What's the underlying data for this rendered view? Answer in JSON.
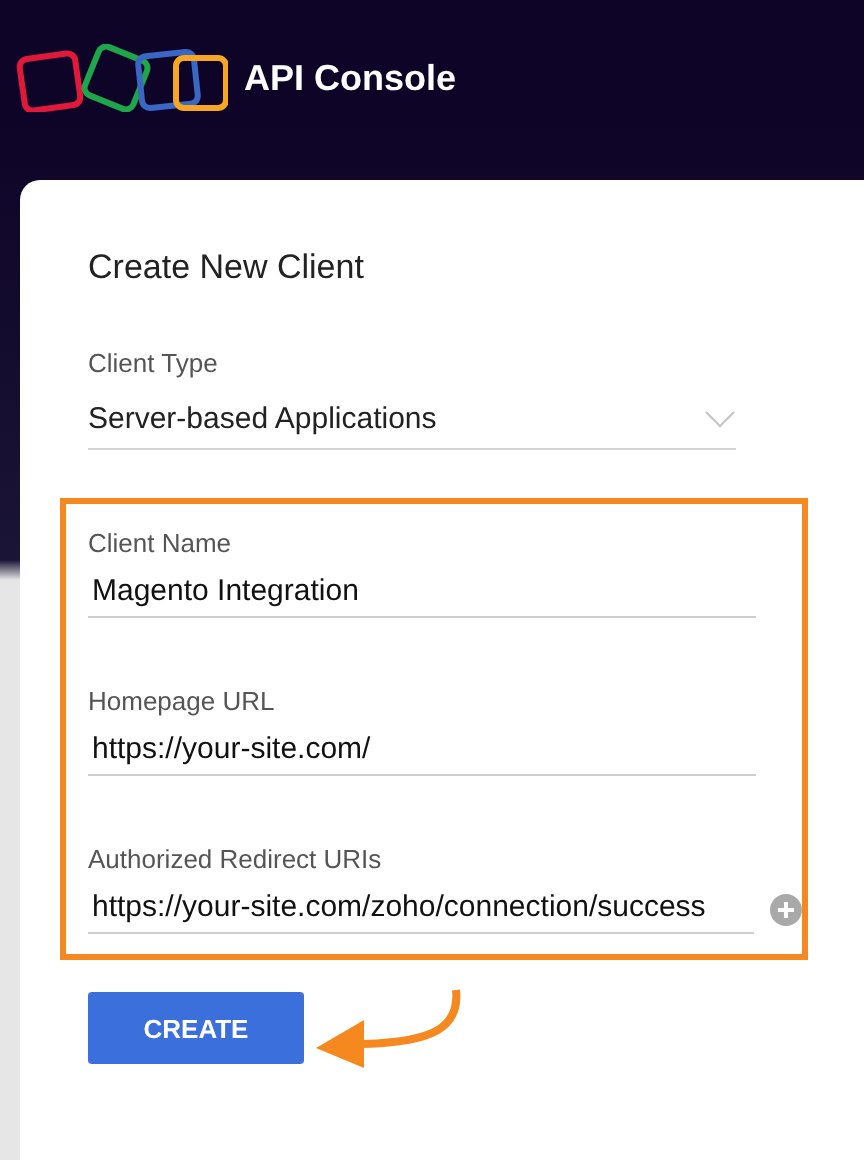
{
  "header": {
    "title": "API Console"
  },
  "form": {
    "title": "Create New Client",
    "client_type": {
      "label": "Client Type",
      "value": "Server-based Applications"
    },
    "fields": [
      {
        "kind": "text",
        "label": "Client Name",
        "value": "Magento Integration"
      },
      {
        "kind": "text",
        "label": "Homepage URL",
        "value": "https://your-site.com/"
      },
      {
        "kind": "text-add",
        "label": "Authorized Redirect URIs",
        "value": "https://your-site.com/zoho/connection/success"
      }
    ],
    "button": "CREATE"
  }
}
